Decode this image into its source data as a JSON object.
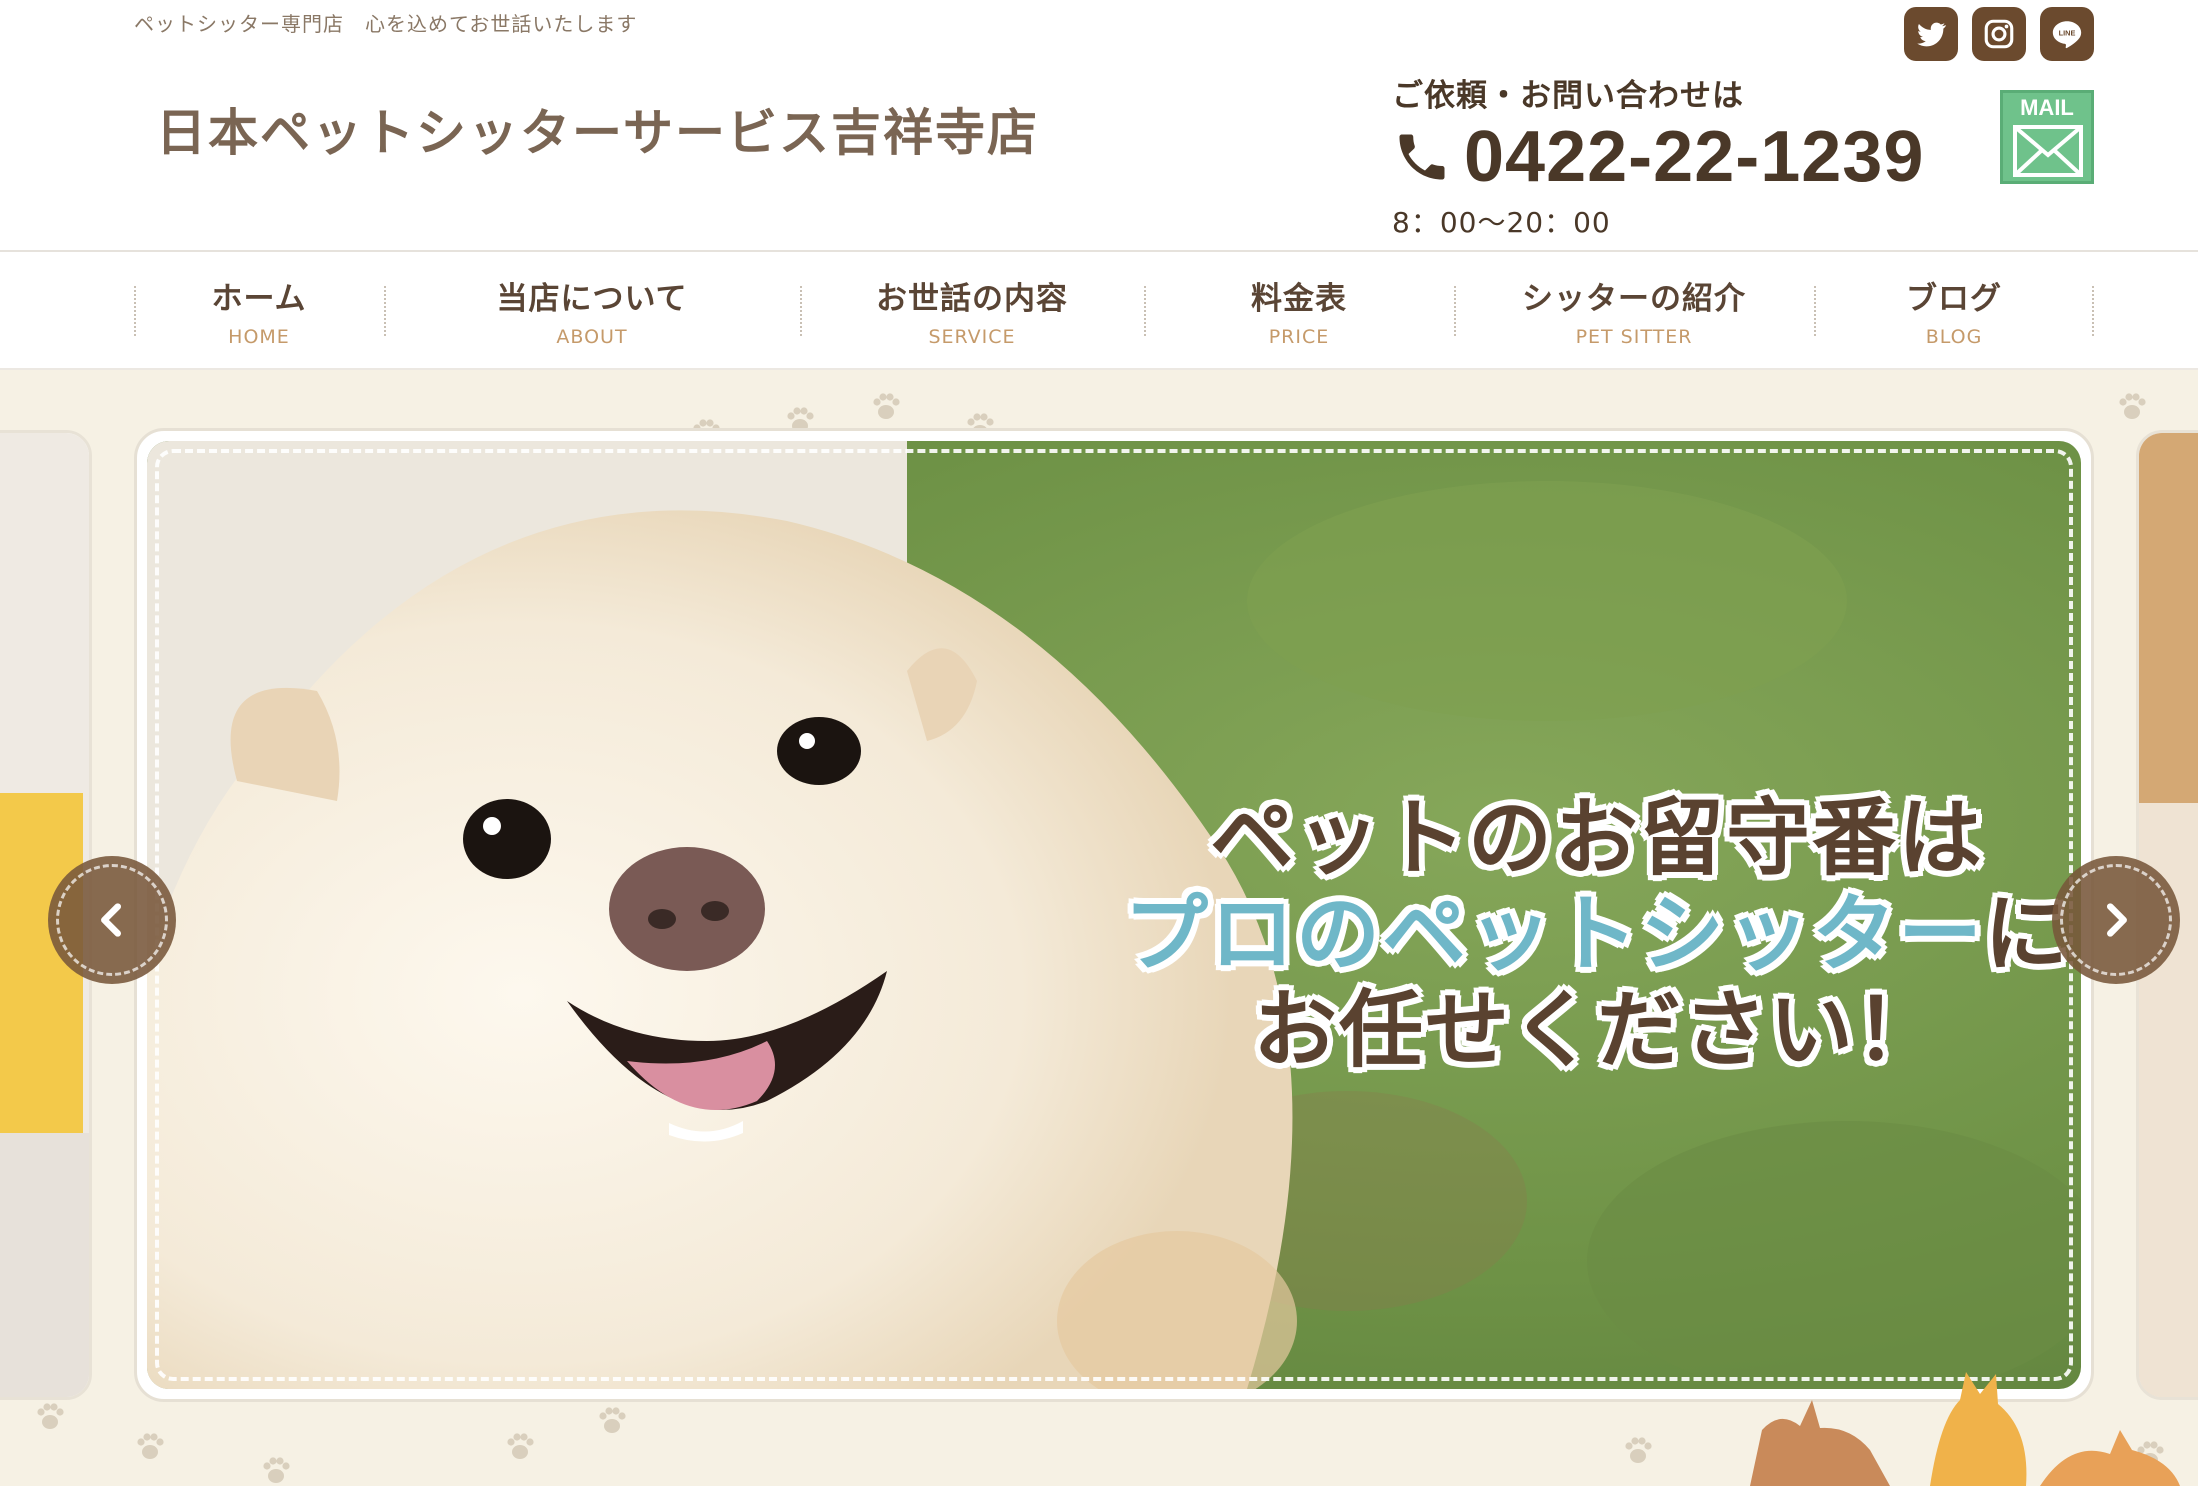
{
  "header": {
    "tagline": "ペットシッター専門店　心を込めてお世話いたします",
    "site_title": "日本ペットシッターサービス吉祥寺店",
    "emblem_text": "日本ペットシッターサービス",
    "social": [
      {
        "name": "twitter",
        "icon": "twitter-icon"
      },
      {
        "name": "instagram",
        "icon": "instagram-icon"
      },
      {
        "name": "line",
        "icon": "line-icon",
        "label": "LINE"
      }
    ],
    "contact": {
      "heading": "ご依頼・お問い合わせは",
      "phone": "0422-22-1239",
      "hours": "8：00〜20：00"
    },
    "mail_label": "MAIL"
  },
  "nav": {
    "items": [
      {
        "jp": "ホーム",
        "en": "HOME"
      },
      {
        "jp": "当店について",
        "en": "ABOUT"
      },
      {
        "jp": "お世話の内容",
        "en": "SERVICE"
      },
      {
        "jp": "料金表",
        "en": "PRICE"
      },
      {
        "jp": "シッターの紹介",
        "en": "PET SITTER"
      },
      {
        "jp": "ブログ",
        "en": "BLOG"
      }
    ]
  },
  "hero": {
    "line1": "ペットのお留守番は",
    "line2_accent": "プロのペットシッター",
    "line2_suffix": "に",
    "line3": "お任せください！"
  },
  "colors": {
    "brown": "#6b4a2e",
    "text_brown": "#5a4535",
    "accent_orange": "#c59a6a",
    "accent_blue": "#6fb7c8",
    "mail_green": "#6fc28b",
    "hero_bg": "#f6f1e4"
  }
}
